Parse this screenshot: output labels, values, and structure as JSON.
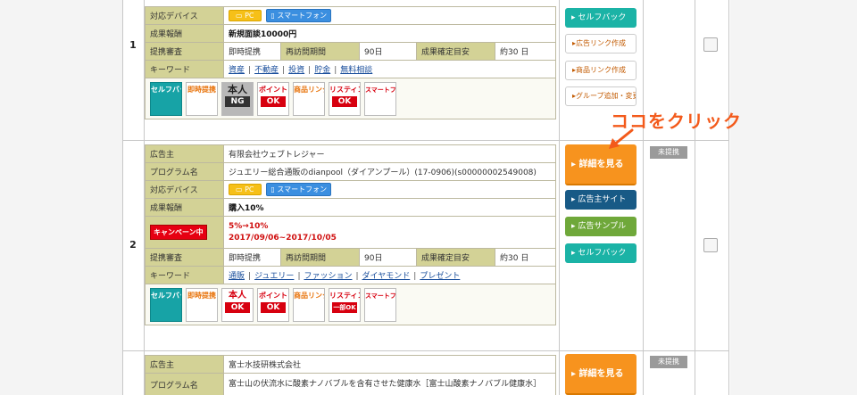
{
  "rows": [
    {
      "num": "1",
      "fields": {
        "device_label": "対応デバイス",
        "pc": "PC",
        "smartphone": "スマートフォン",
        "reward_label": "成果報酬",
        "reward_value": "新規面談10000円",
        "screening_label": "提携審査",
        "screening_value": "即時提携",
        "revisit_label": "再訪問期間",
        "revisit_value": "90日",
        "confirm_label": "成果確定目安",
        "confirm_value": "約30 日",
        "keyword_label": "キーワード",
        "keywords": [
          "資産",
          "不動産",
          "投資",
          "貯金",
          "無料相談"
        ]
      },
      "icons": {
        "self_back": "セルフバック",
        "instant": "即時提携",
        "person": "本人",
        "person_status": "NG",
        "point": "ポイント",
        "point_status": "OK",
        "product": "商品リンク",
        "listing": "リスティング",
        "listing_status": "OK",
        "smartphone_opt": "スマートフォン最適化サイト対応"
      },
      "buttons": {
        "self_back": "セルフバック",
        "ad_link": "広告リンク作成",
        "product_link": "商品リンク作成",
        "group": "グループ追加・変更"
      }
    },
    {
      "num": "2",
      "fields": {
        "advertiser_label": "広告主",
        "advertiser_value": "有限会社ウェブトレジャー",
        "program_label": "プログラム名",
        "program_value": "ジュエリー総合通販のdianpool（ダイアンプール）(17-0906)(s00000002549008)",
        "device_label": "対応デバイス",
        "pc": "PC",
        "smartphone": "スマートフォン",
        "reward_label": "成果報酬",
        "reward_value": "購入10%",
        "campaign_badge": "キャンペーン中",
        "campaign_line1": "5%→10%",
        "campaign_line2": "2017/09/06~2017/10/05",
        "screening_label": "提携審査",
        "screening_value": "即時提携",
        "revisit_label": "再訪問期間",
        "revisit_value": "90日",
        "confirm_label": "成果確定目安",
        "confirm_value": "約30 日",
        "keyword_label": "キーワード",
        "keywords": [
          "通販",
          "ジュエリー",
          "ファッション",
          "ダイヤモンド",
          "プレゼント"
        ]
      },
      "icons": {
        "self_back": "セルフバック",
        "instant": "即時提携",
        "person": "本人",
        "person_status": "OK",
        "point": "ポイント",
        "point_status": "OK",
        "product": "商品リンク",
        "listing": "リスティング",
        "listing_status": "一部OK",
        "smartphone_opt": "スマートフォン最適化サイト対応"
      },
      "buttons": {
        "details": "詳細を見る",
        "advertiser_site": "広告主サイト",
        "ad_sample": "広告サンプル",
        "self_back": "セルフバック"
      },
      "status_badge": "未提携"
    },
    {
      "num": "3",
      "fields": {
        "advertiser_label": "広告主",
        "advertiser_value": "富士水技研株式会社",
        "program_label": "プログラム名",
        "program_value": "富士山の伏流水に酸素ナノバブルを含有させた健康水［富士山酸素ナノバブル健康水］"
      },
      "buttons": {
        "details": "詳細を見る"
      },
      "status_badge": "未提携"
    }
  ],
  "annotation": "ココをクリック",
  "colors": {
    "label_bg": "#d3d296",
    "orange_button": "#f7931e",
    "navy_button": "#185a86",
    "green_button": "#6fa83a",
    "teal_button": "#1bb3a6",
    "annotation": "#f35a1b"
  }
}
